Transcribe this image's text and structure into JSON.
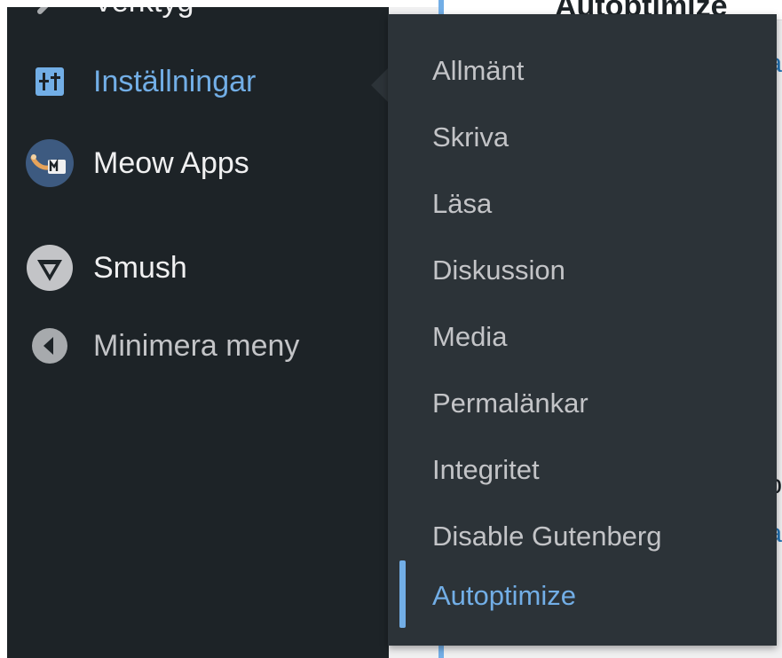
{
  "sidebar": {
    "items": [
      {
        "label": "Verktyg",
        "icon": "wrench-icon",
        "state": "default"
      },
      {
        "label": "Inställningar",
        "icon": "settings-sliders-icon",
        "state": "current"
      },
      {
        "label": "Meow Apps",
        "icon": "meow-apps-logo-icon",
        "state": "default"
      },
      {
        "label": "Smush",
        "icon": "smush-logo-icon",
        "state": "default"
      },
      {
        "label": "Minimera meny",
        "icon": "collapse-arrow-icon",
        "state": "muted"
      }
    ]
  },
  "flyout": {
    "parent": "Inställningar",
    "items": [
      {
        "label": "Allmänt"
      },
      {
        "label": "Skriva"
      },
      {
        "label": "Läsa"
      },
      {
        "label": "Diskussion"
      },
      {
        "label": "Media"
      },
      {
        "label": "Permalänkar"
      },
      {
        "label": "Integritet"
      },
      {
        "label": "Disable Gutenberg"
      },
      {
        "label": "Autoptimize",
        "active": true
      }
    ]
  },
  "content": {
    "page_title": "Autoptimize",
    "edge_glyphs": [
      "a",
      "b",
      "a"
    ]
  },
  "colors": {
    "sidebar_bg": "#1d2327",
    "flyout_bg": "#2c3338",
    "accent": "#72aee6",
    "text_light": "#f0f0f1",
    "text_muted": "#c3c4c7"
  }
}
